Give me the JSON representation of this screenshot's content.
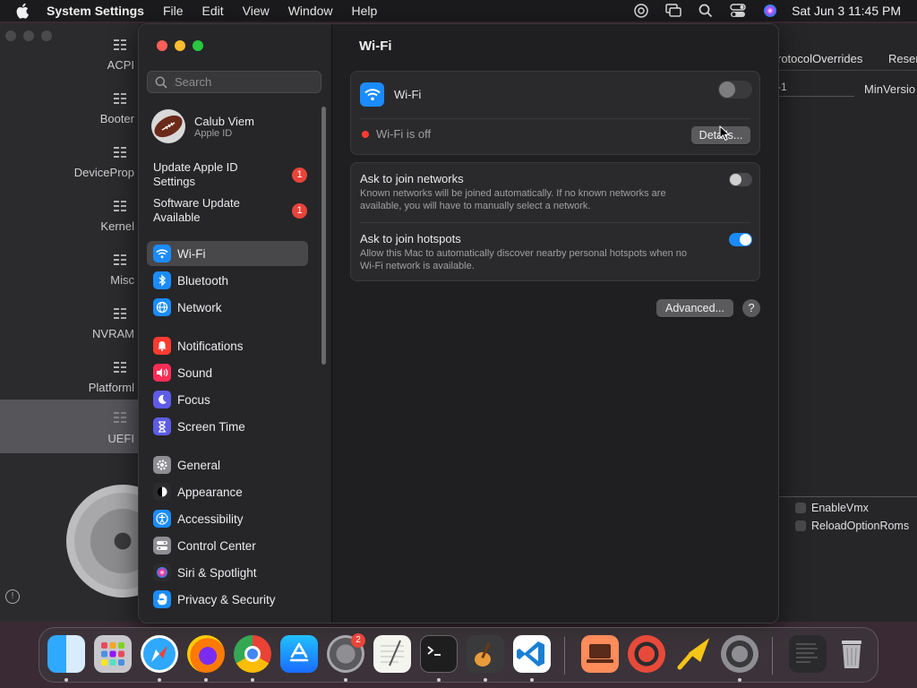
{
  "menubar": {
    "app_name": "System Settings",
    "menus": [
      "File",
      "Edit",
      "View",
      "Window",
      "Help"
    ],
    "clock": "Sat Jun 3  11:45 PM"
  },
  "background_app": {
    "sidebar": [
      "ACPI",
      "Booter",
      "DeviceProp",
      "Kernel",
      "Misc",
      "NVRAM",
      "Platforml",
      "UEFI"
    ],
    "selected": "UEFI",
    "header_left": "rotocolOverrides",
    "header_right": "Reser",
    "field_value": "-1",
    "field_label": "MinVersio",
    "checkboxes": [
      "EnableVmx",
      "ReloadOptionRoms"
    ]
  },
  "sidebar": {
    "search_placeholder": "Search",
    "account": {
      "name": "Calub Viem",
      "subtitle": "Apple ID"
    },
    "alerts": [
      {
        "label": "Update Apple ID Settings",
        "badge": "1"
      },
      {
        "label": "Software Update Available",
        "badge": "1"
      }
    ],
    "items": [
      {
        "label": "Wi-Fi",
        "icon": "wifi-icon",
        "color": "#1a8cff"
      },
      {
        "label": "Bluetooth",
        "icon": "bluetooth-icon",
        "color": "#1a8cff"
      },
      {
        "label": "Network",
        "icon": "globe-icon",
        "color": "#1a8cff"
      },
      {
        "label": "Notifications",
        "icon": "bell-icon",
        "color": "#ff3b30"
      },
      {
        "label": "Sound",
        "icon": "speaker-icon",
        "color": "#ff2d55"
      },
      {
        "label": "Focus",
        "icon": "moon-icon",
        "color": "#5e5ce6"
      },
      {
        "label": "Screen Time",
        "icon": "hourglass-icon",
        "color": "#5e5ce6"
      },
      {
        "label": "General",
        "icon": "gear-icon",
        "color": "#8e8e93"
      },
      {
        "label": "Appearance",
        "icon": "appearance-icon",
        "color": "#2c2c2e"
      },
      {
        "label": "Accessibility",
        "icon": "accessibility-icon",
        "color": "#1a8cff"
      },
      {
        "label": "Control Center",
        "icon": "control-center-icon",
        "color": "#8e8e93"
      },
      {
        "label": "Siri & Spotlight",
        "icon": "siri-icon",
        "color": "#2c2c2e"
      },
      {
        "label": "Privacy & Security",
        "icon": "hand-icon",
        "color": "#1a8cff"
      }
    ],
    "selected": "Wi-Fi"
  },
  "content": {
    "title": "Wi-Fi",
    "wifi_label": "Wi-Fi",
    "wifi_enabled": false,
    "status_text": "Wi-Fi is off",
    "details_button": "Details...",
    "ask_networks": {
      "title": "Ask to join networks",
      "desc": "Known networks will be joined automatically. If no known networks are available, you will have to manually select a network.",
      "enabled": false
    },
    "ask_hotspots": {
      "title": "Ask to join hotspots",
      "desc": "Allow this Mac to automatically discover nearby personal hotspots when no Wi-Fi network is available.",
      "enabled": true
    },
    "advanced_button": "Advanced...",
    "help_button": "?"
  },
  "dock": {
    "apps": [
      "Finder",
      "Launchpad",
      "Safari",
      "Firefox",
      "Chrome",
      "App Store",
      "System Settings",
      "TextEdit",
      "Terminal",
      "GarageBand",
      "Visual Studio Code",
      "Screen Sharing",
      "Network Radar",
      "Pointer",
      "OpenCore Configurator",
      "Document",
      "Trash"
    ],
    "system_settings_badge": "2"
  },
  "colors": {
    "accent": "#1a8cff",
    "badge": "#e8443a",
    "status_off": "#ff3b30"
  }
}
